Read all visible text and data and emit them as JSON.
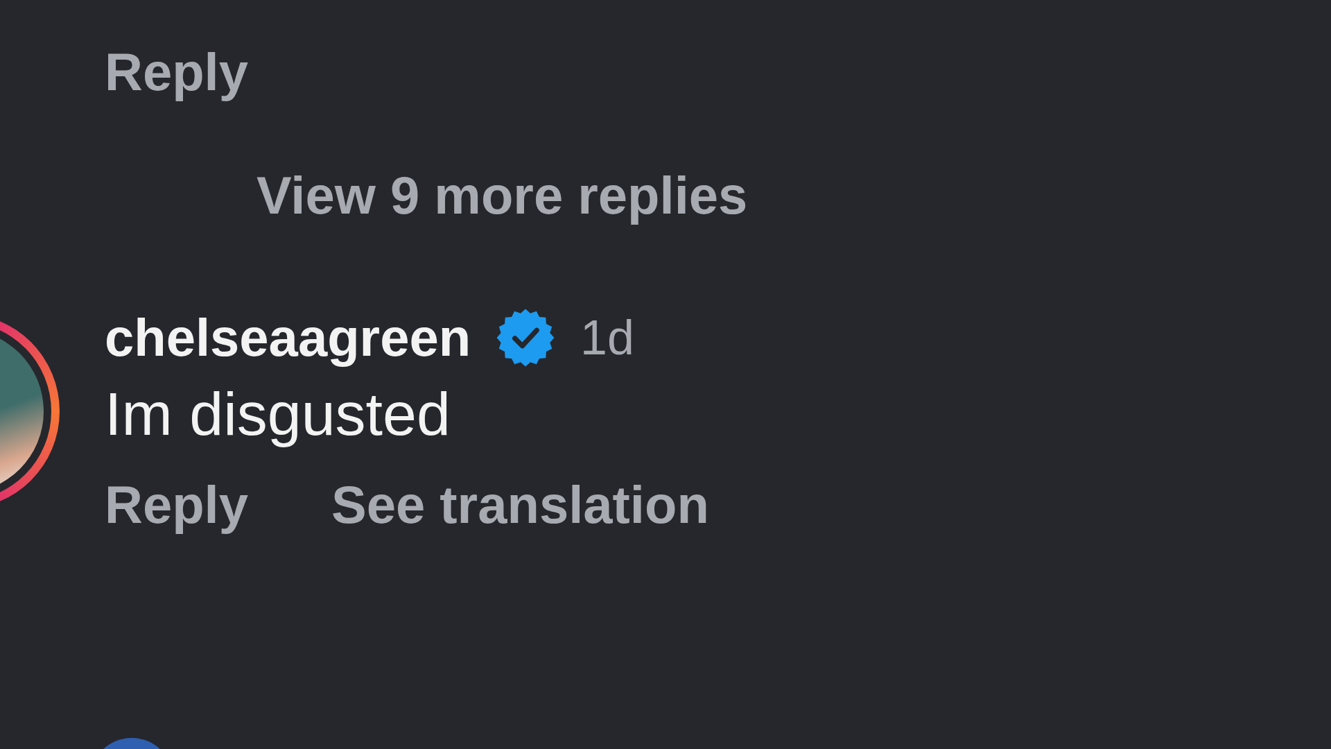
{
  "previous_comment": {
    "reply_label": "Reply"
  },
  "view_replies": "View 9 more replies",
  "comment": {
    "username": "chelseaagreen",
    "verified": true,
    "time": "1d",
    "text": "Im disgusted",
    "actions": [
      "Reply",
      "See translation"
    ]
  }
}
